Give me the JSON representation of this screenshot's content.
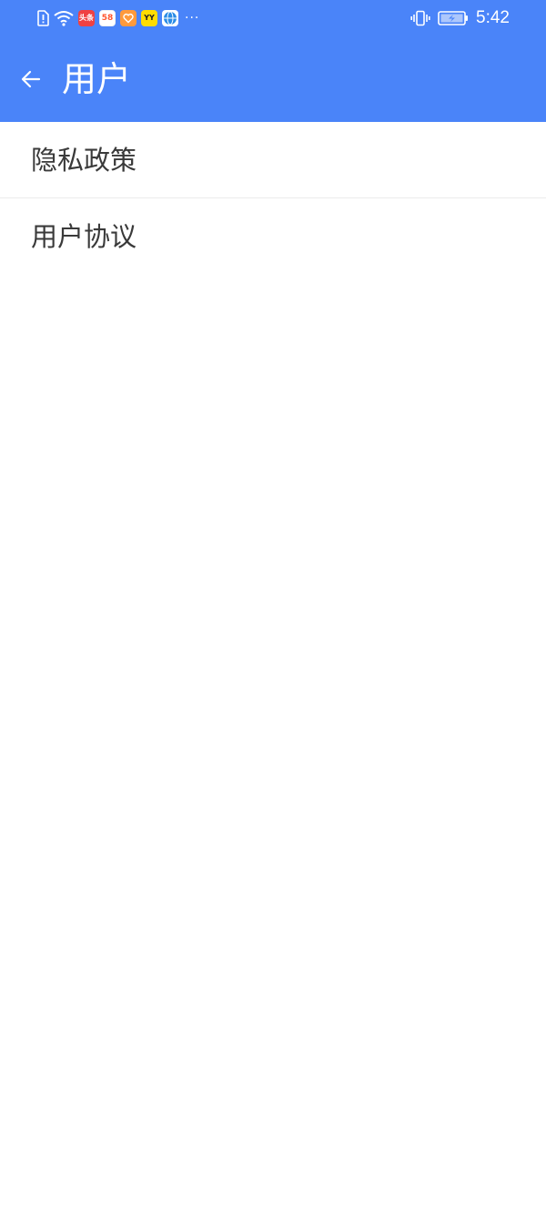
{
  "status_bar": {
    "time": "5:42",
    "more_indicator": "···",
    "icons": [
      "sim-alert-icon",
      "wifi-icon",
      "toutiao-app-icon",
      "58-app-icon",
      "heart-app-icon",
      "yy-app-icon",
      "browser-app-icon",
      "vibrate-icon",
      "battery-icon"
    ],
    "app_icon_labels": {
      "toutiao": "头条",
      "app58": "58",
      "yy": "YY"
    }
  },
  "toolbar": {
    "title": "用户",
    "background_color": "#4a84f9",
    "back_icon": "back-arrow-icon"
  },
  "menu": {
    "items": [
      {
        "label": "隐私政策"
      },
      {
        "label": "用户协议"
      }
    ]
  }
}
